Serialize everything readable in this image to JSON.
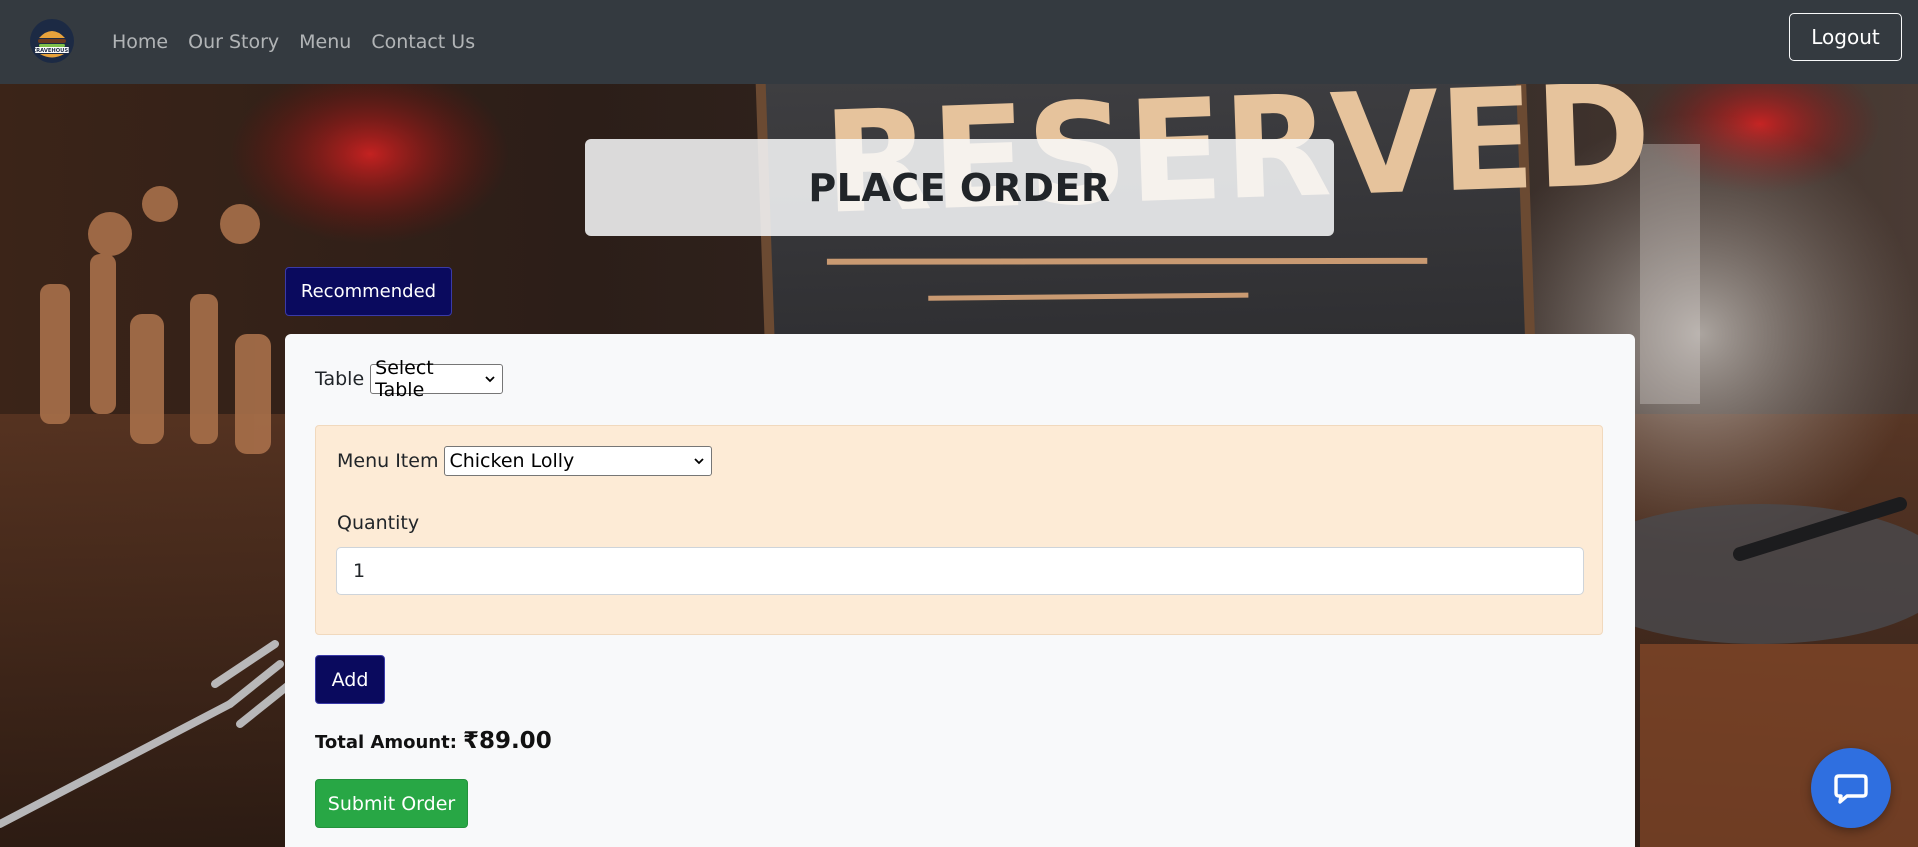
{
  "navbar": {
    "brand_logo_text": "CRAVEHOUSE",
    "links": [
      "Home",
      "Our Story",
      "Menu",
      "Contact Us"
    ],
    "logout_label": "Logout"
  },
  "background_sign_text": "RESERVED",
  "page": {
    "title": "PLACE ORDER",
    "recommended_label": "Recommended"
  },
  "order_form": {
    "table_label": "Table",
    "table_select_value": "Select Table",
    "menu_item_label": "Menu Item",
    "menu_item_value": "Chicken Lolly",
    "quantity_label": "Quantity",
    "quantity_value": "1",
    "add_label": "Add",
    "total_label": "Total Amount:",
    "total_value": "₹89.00",
    "submit_label": "Submit Order"
  },
  "colors": {
    "navbar": "#343a40",
    "primary_navy": "#0a0a5e",
    "success": "#28a745",
    "item_panel": "#fdebd6",
    "chat_fab": "#2f6fe0"
  },
  "icons": {
    "chat": "chat-bubble-icon",
    "select_arrow": "chevron-down-icon"
  }
}
